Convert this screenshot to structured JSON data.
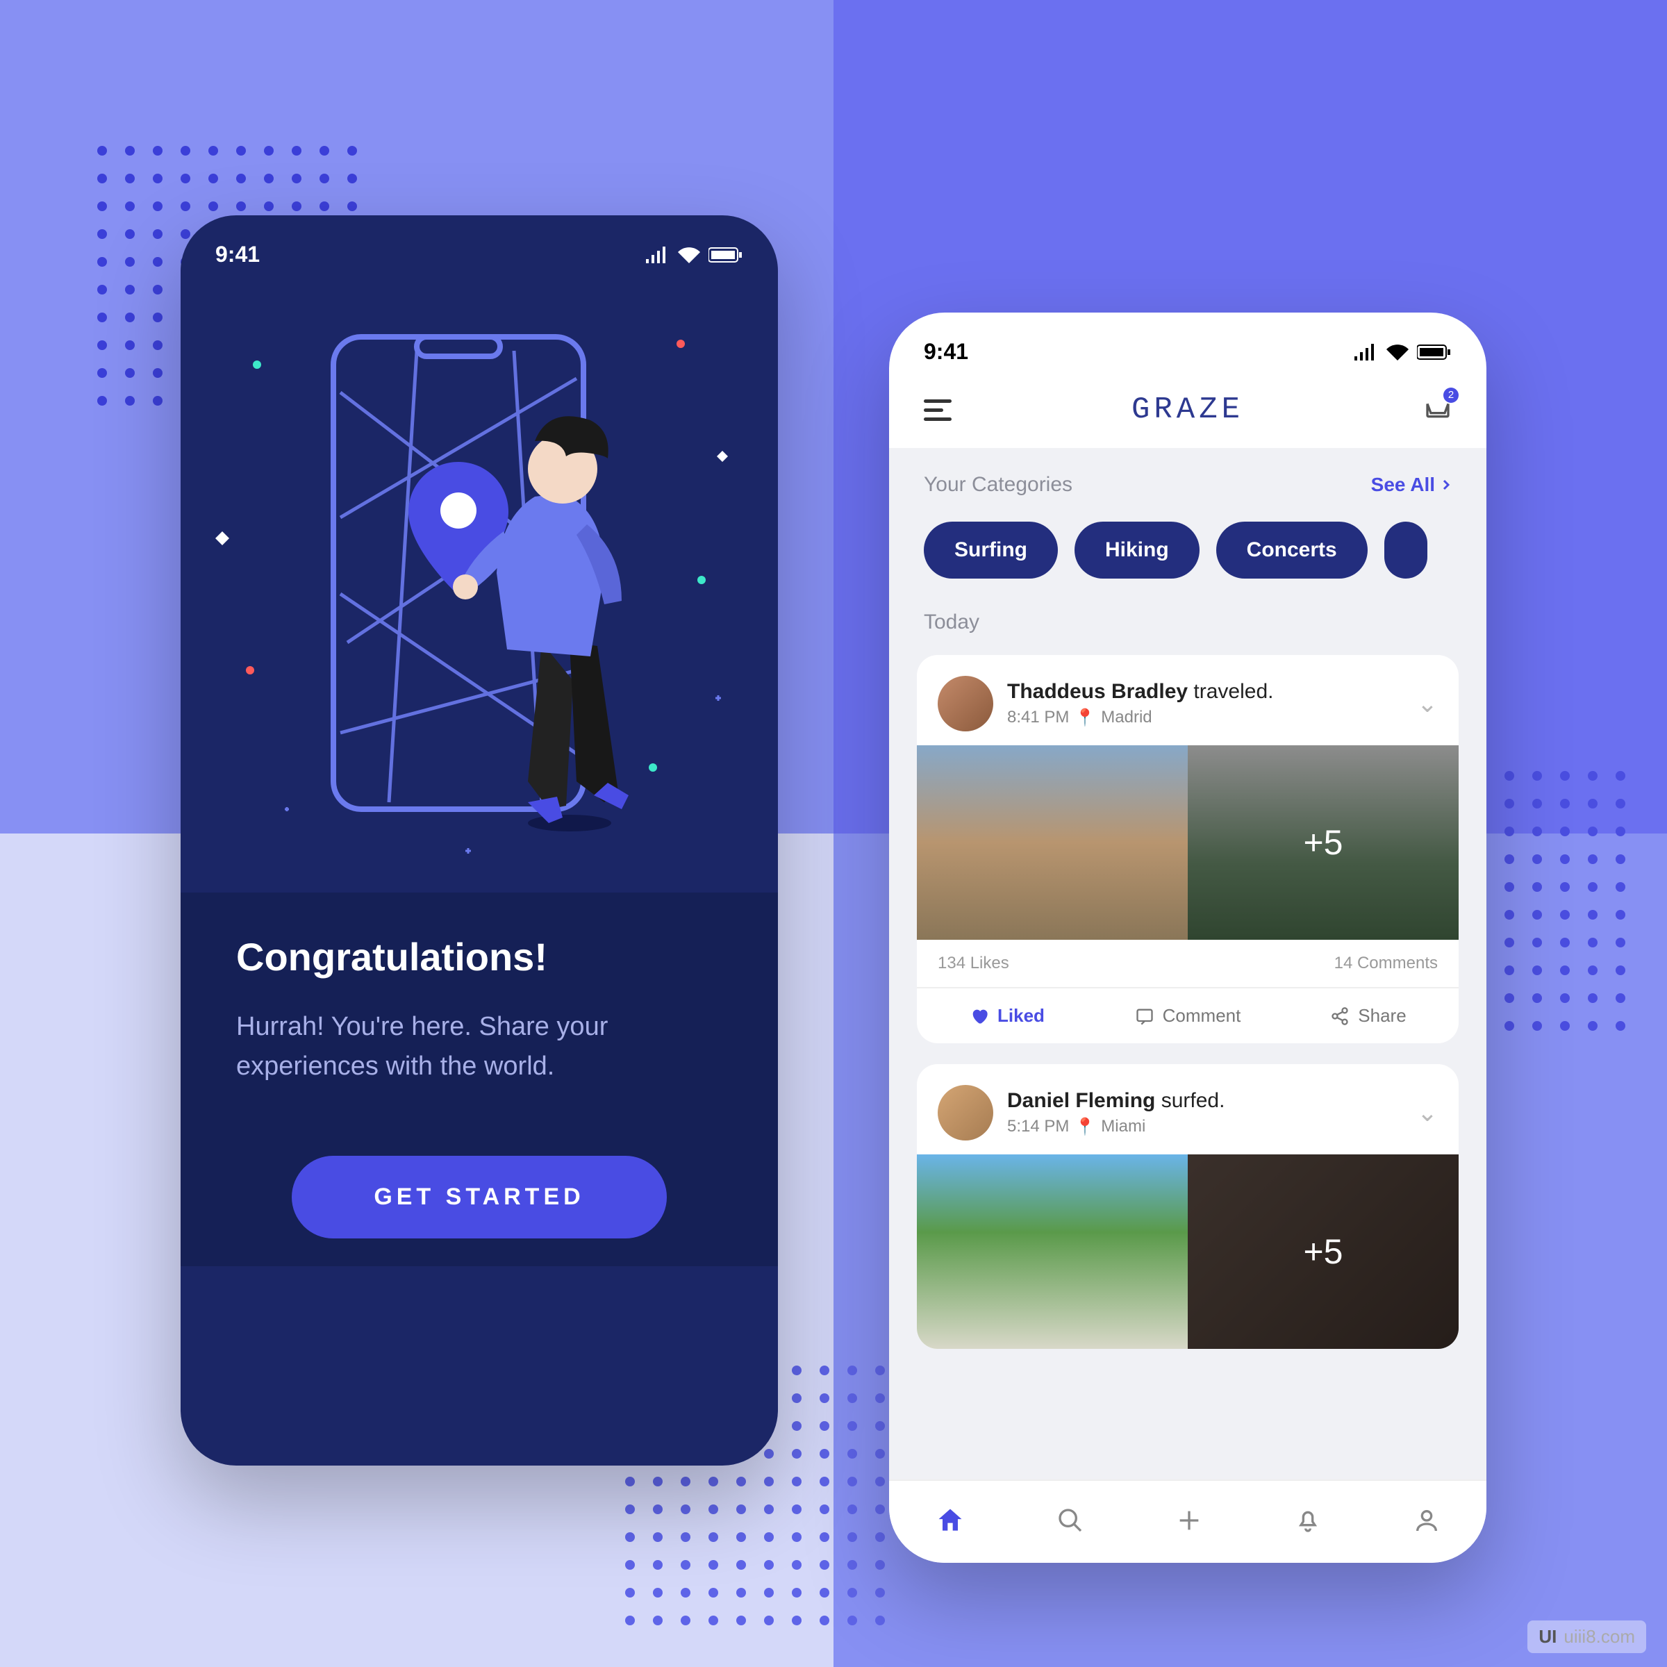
{
  "statusbar": {
    "time": "9:41"
  },
  "onboarding": {
    "title": "Congratulations!",
    "subtitle": "Hurrah! You're here. Share your experiences with the world.",
    "cta": "GET STARTED"
  },
  "app": {
    "logo": "GRAZE",
    "inbox_badge": "2",
    "categories": {
      "label": "Your Categories",
      "see_all": "See All",
      "items": [
        "Surfing",
        "Hiking",
        "Concerts"
      ]
    },
    "today_label": "Today",
    "posts": [
      {
        "user": "Thaddeus Bradley",
        "verb": "traveled.",
        "time": "8:41 PM",
        "location": "Madrid",
        "more_count": "+5",
        "likes": "134 Likes",
        "comments": "14 Comments",
        "actions": {
          "liked": "Liked",
          "comment": "Comment",
          "share": "Share"
        }
      },
      {
        "user": "Daniel Fleming",
        "verb": "surfed.",
        "time": "5:14 PM",
        "location": "Miami",
        "more_count": "+5"
      }
    ]
  },
  "watermark": "uiii8.com"
}
